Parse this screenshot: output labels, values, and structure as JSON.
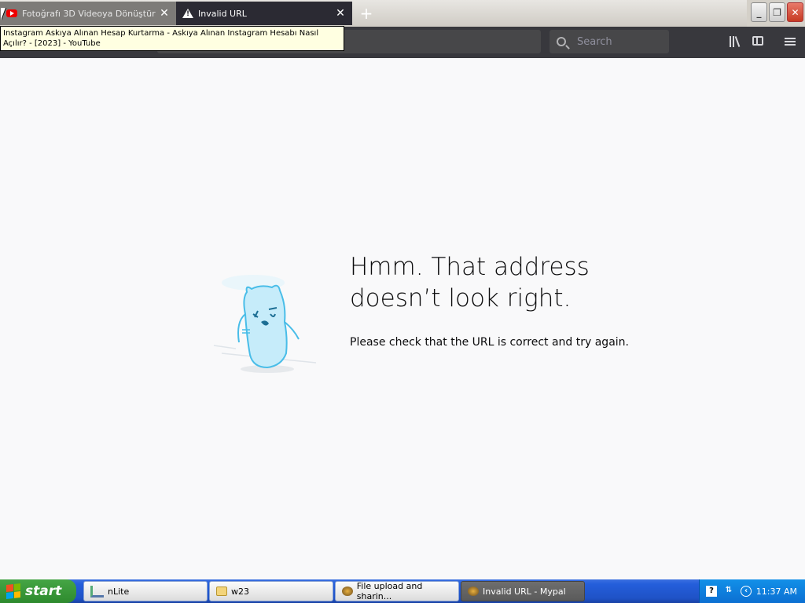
{
  "tabs": [
    {
      "title": "Fotoğrafı 3D Videoya Dönüştür",
      "icon": "youtube-icon",
      "state": "inactive"
    },
    {
      "title": "Invalid URL",
      "icon": "warning-icon",
      "state": "active"
    }
  ],
  "new_tab_symbol": "+",
  "window_buttons": {
    "minimize": "_",
    "restore": "❐",
    "close": "✕"
  },
  "tooltip": "Instagram Askıya Alınan Hesap Kurtarma - Askıya Alınan Instagram Hesabı Nasıl Açılır? - [2023] - YouTube",
  "search": {
    "placeholder": "Search"
  },
  "error": {
    "title": "Hmm. That address doesn’t look right.",
    "description": "Please check that the URL is correct and try again."
  },
  "taskbar": {
    "start_label": "start",
    "items": [
      {
        "label": "nLite",
        "icon": "nlite-icon",
        "active": false
      },
      {
        "label": "w23",
        "icon": "folder-icon",
        "active": false
      },
      {
        "label": "File upload and sharin...",
        "icon": "browser-icon",
        "active": false
      },
      {
        "label": "Invalid URL - Mypal",
        "icon": "browser-icon",
        "active": true
      }
    ],
    "clock": "11:37 AM"
  },
  "colors": {
    "toolbar": "#38383d",
    "active_tab": "#2b2a33",
    "page_bg": "#f9f9fa",
    "taskbar": "#245edb",
    "start": "#3c9c3c"
  }
}
